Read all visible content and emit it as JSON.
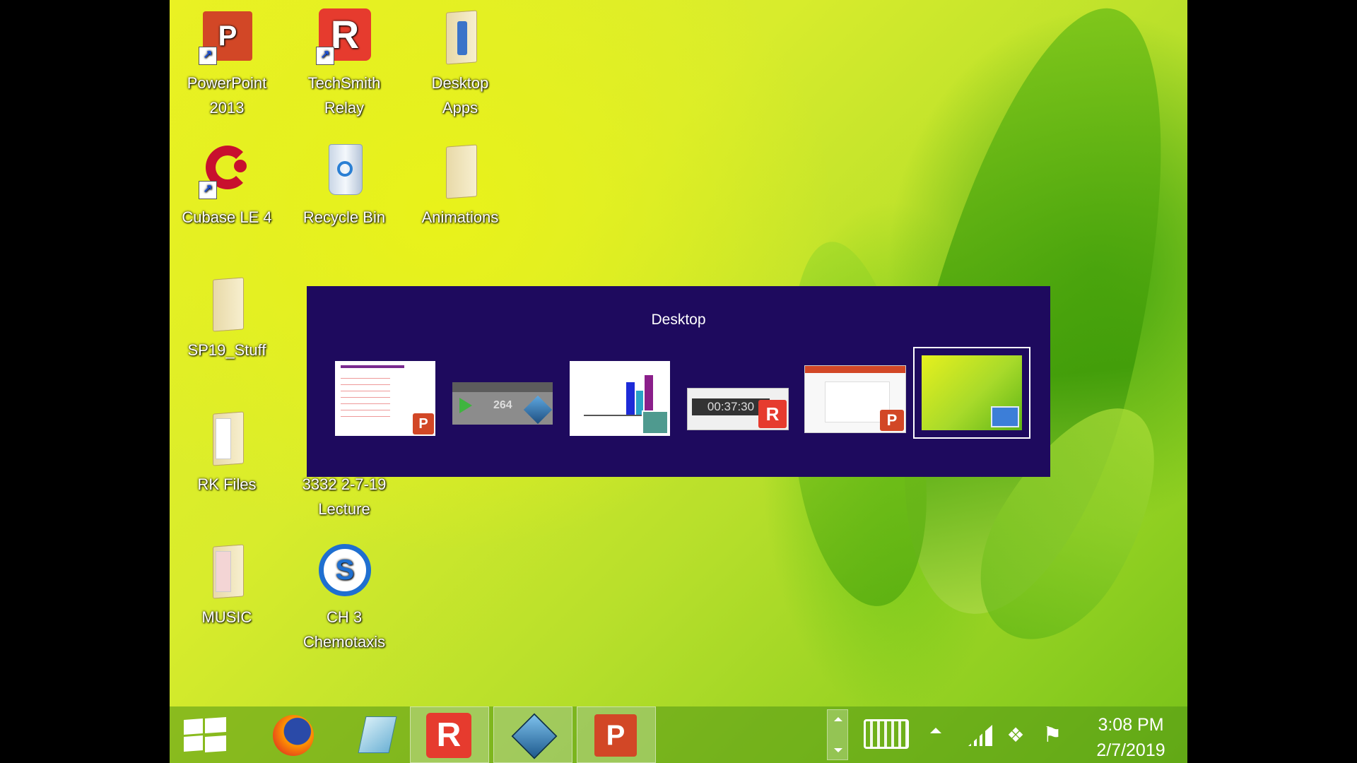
{
  "desktop_icons": [
    {
      "label_line1": "PowerPoint",
      "label_line2": "2013",
      "icon": "powerpoint-icon"
    },
    {
      "label_line1": "TechSmith",
      "label_line2": "Relay",
      "icon": "techsmith-relay-icon"
    },
    {
      "label_line1": "Desktop",
      "label_line2": "Apps",
      "icon": "folder-icon"
    },
    {
      "label_line1": "Cubase LE 4",
      "label_line2": "",
      "icon": "cubase-icon"
    },
    {
      "label_line1": "Recycle Bin",
      "label_line2": "",
      "icon": "recycle-bin-icon"
    },
    {
      "label_line1": "Animations",
      "label_line2": "",
      "icon": "folder-icon"
    },
    {
      "label_line1": "SP19_Stuff",
      "label_line2": "",
      "icon": "folder-icon"
    },
    {
      "label_line1": "RK Files",
      "label_line2": "",
      "icon": "folder-icon"
    },
    {
      "label_line1": "3332 2-7-19",
      "label_line2": "Lecture",
      "icon": "folder-icon"
    },
    {
      "label_line1": "MUSIC",
      "label_line2": "",
      "icon": "folder-icon"
    },
    {
      "label_line1": "CH 3",
      "label_line2": "Chemotaxis",
      "icon": "snagit-video-icon"
    }
  ],
  "switcher": {
    "title": "Desktop",
    "thumbnails": [
      {
        "app": "PowerPoint slide",
        "badge": "P",
        "badge_color": "#d24726"
      },
      {
        "app": "Media player",
        "counter": "264",
        "badge_color": "#2a6fae"
      },
      {
        "app": "Chart window",
        "badge_color": "#4f9a8f"
      },
      {
        "app": "TechSmith Relay recorder",
        "timer": "00:37:30",
        "badge": "R",
        "badge_color": "#e63b2e"
      },
      {
        "app": "PowerPoint window",
        "badge": "P",
        "badge_color": "#d24726"
      },
      {
        "app": "Desktop",
        "selected": true
      }
    ]
  },
  "taskbar": {
    "buttons": [
      {
        "name": "start",
        "icon": "windows-logo-icon"
      },
      {
        "name": "firefox",
        "icon": "firefox-icon"
      },
      {
        "name": "notepad-like",
        "icon": "blue-app-icon"
      },
      {
        "name": "techsmith-relay",
        "icon": "techsmith-relay-icon",
        "label": "R"
      },
      {
        "name": "3d-cube-app",
        "icon": "cube-icon"
      },
      {
        "name": "powerpoint",
        "icon": "powerpoint-icon",
        "label": "P"
      }
    ],
    "clock": {
      "time": "3:08 PM",
      "date": "2/7/2019"
    }
  }
}
